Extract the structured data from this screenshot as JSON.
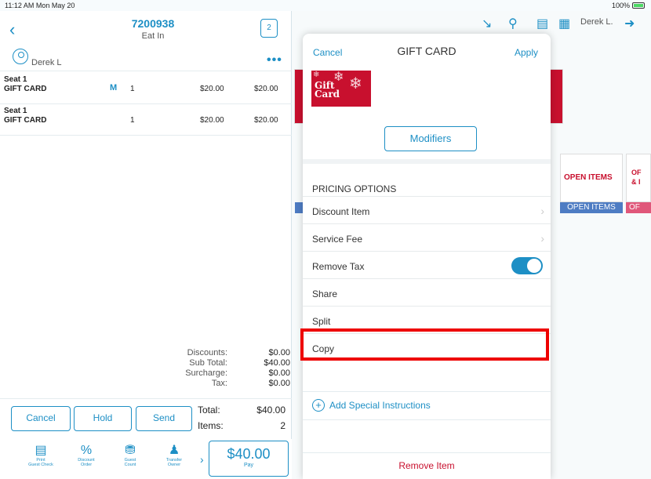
{
  "status": {
    "time": "11:12 AM  Mon May 20",
    "battery": "100%"
  },
  "order": {
    "number": "7200938",
    "type": "Eat In",
    "guest_count": "2",
    "user": "Derek L"
  },
  "items": [
    {
      "seat": "Seat 1",
      "name": "GIFT CARD",
      "modifier": "M",
      "qty": "1",
      "price": "$20.00",
      "ext": "$20.00"
    },
    {
      "seat": "Seat 1",
      "name": "GIFT CARD",
      "modifier": "",
      "qty": "1",
      "price": "$20.00",
      "ext": "$20.00"
    }
  ],
  "totals": {
    "discounts_label": "Discounts:",
    "discounts": "$0.00",
    "subtotal_label": "Sub Total:",
    "subtotal": "$40.00",
    "surcharge_label": "Surcharge:",
    "surcharge": "$0.00",
    "tax_label": "Tax:",
    "tax": "$0.00",
    "total_label": "Total:",
    "total": "$40.00",
    "items_label": "Items:",
    "items": "2"
  },
  "actions": {
    "cancel": "Cancel",
    "hold": "Hold",
    "send": "Send"
  },
  "bottom": [
    {
      "icon": "print-icon",
      "label": "Print\nGuest Check"
    },
    {
      "icon": "percent-icon",
      "label": "Discount\nOrder"
    },
    {
      "icon": "guest-icon",
      "label": "Guest\nCount"
    },
    {
      "icon": "transfer-icon",
      "label": "Transfer\nOwner"
    }
  ],
  "pay": {
    "amount": "$40.00",
    "label": "Pay"
  },
  "topbar": {
    "user": "Derek L."
  },
  "tiles": {
    "open_items": "OPEN ITEMS",
    "open_items_label": "OPEN ITEMS",
    "partial": "OF",
    "partial2": "& I"
  },
  "modal": {
    "cancel": "Cancel",
    "title": "GIFT CARD",
    "apply": "Apply",
    "gift_text1": "Gift",
    "gift_text2": "Card",
    "modifiers": "Modifiers",
    "section": "PRICING OPTIONS",
    "options": [
      "Discount Item",
      "Service Fee",
      "Remove Tax",
      "Share",
      "Split",
      "Copy"
    ],
    "special": "Add Special Instructions",
    "remove": "Remove Item"
  },
  "colors": {
    "accent": "#1d8fc5",
    "danger": "#c8102e",
    "highlight": "#ee0000"
  }
}
